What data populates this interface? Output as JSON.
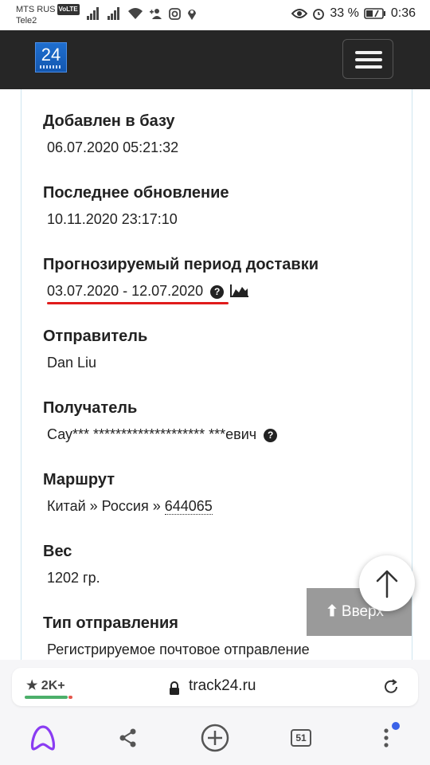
{
  "status_bar": {
    "carrier1": "MTS RUS",
    "volte": "VoLTE",
    "carrier2": "Tele2",
    "battery": "33 %",
    "time": "0:36"
  },
  "header": {
    "logo_text": "24"
  },
  "fields": [
    {
      "label": "Добавлен в базу",
      "value": "06.07.2020 05:21:32"
    },
    {
      "label": "Последнее обновление",
      "value": "10.11.2020 23:17:10"
    },
    {
      "label": "Прогнозируемый период доставки",
      "value": "03.07.2020 - 12.07.2020"
    },
    {
      "label": "Отправитель",
      "value": "Dan Liu"
    },
    {
      "label": "Получатель",
      "value": "Сау*** ******************** ***евич"
    },
    {
      "label": "Маршрут",
      "value": "Китай » Россия » ",
      "postcode": "644065"
    },
    {
      "label": "Вес",
      "value": "1202 гр."
    },
    {
      "label": "Тип отправления",
      "value": "Регистрируемое почтовое отправление"
    }
  ],
  "help_icon_glyph": "?",
  "up_button": {
    "arrow": "⬆",
    "label": "Вверх"
  },
  "browser": {
    "rating": "★ 2K+",
    "url": "track24.ru",
    "tab_count": "51"
  }
}
